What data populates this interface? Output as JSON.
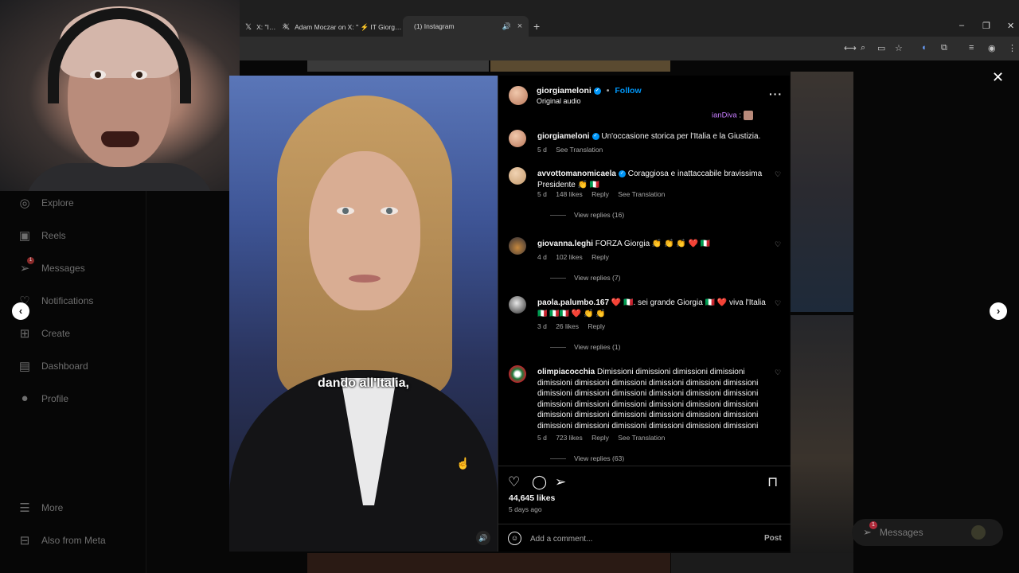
{
  "browser": {
    "tabs": [
      {
        "label": "X: \"I…",
        "active": false
      },
      {
        "label": "Adam Moczar on X: \" ⚡ IT Giorg…",
        "active": false
      },
      {
        "label": "(1) Instagram",
        "active": true
      }
    ],
    "new_tab": "+",
    "window_controls": {
      "minimize": "–",
      "restore": "❐",
      "close": "✕"
    }
  },
  "sidebar": {
    "items": [
      {
        "label": "Explore",
        "icon": "compass-icon"
      },
      {
        "label": "Reels",
        "icon": "reels-icon"
      },
      {
        "label": "Messages",
        "icon": "messenger-icon",
        "badge": "1"
      },
      {
        "label": "Notifications",
        "icon": "heart-icon"
      },
      {
        "label": "Create",
        "icon": "plus-square-icon"
      },
      {
        "label": "Dashboard",
        "icon": "chart-icon"
      },
      {
        "label": "Profile",
        "icon": "avatar-icon"
      }
    ],
    "more": "More",
    "also_from_meta": "Also from Meta"
  },
  "post": {
    "username": "giorgiameloni",
    "follow": "Follow",
    "audio": "Original audio",
    "subtitle": "dando all'Italia,",
    "pinned_user": "ianDiva",
    "caption_user": "giorgiameloni",
    "caption_text": "Un'occasione storica per l'Italia e la Giustizia.",
    "caption_age": "5 d",
    "caption_translation": "See Translation",
    "likes": "44,645 likes",
    "posted": "5 days ago",
    "comment_placeholder": "Add a comment...",
    "post_button": "Post"
  },
  "comments": [
    {
      "user": "avvottomanomicaela",
      "verified": true,
      "text": "Coraggiosa e inattaccabile bravissima Presidente 👏 🇮🇹",
      "age": "5 d",
      "likes": "148 likes",
      "reply": "Reply",
      "translate": "See Translation",
      "replies": "View replies (16)"
    },
    {
      "user": "giovanna.leghi",
      "verified": false,
      "text": "FORZA Giorgia 👏 👏 👏 ❤️ 🇮🇹",
      "age": "4 d",
      "likes": "102 likes",
      "reply": "Reply",
      "translate": "",
      "replies": "View replies (7)"
    },
    {
      "user": "paola.palumbo.167",
      "verified": false,
      "text": "❤️ 🇮🇹. sei grande Giorgia 🇮🇹 ❤️ viva l'Italia 🇮🇹 🇮🇹🇮🇹 ❤️ 👏 👏",
      "age": "3 d",
      "likes": "26 likes",
      "reply": "Reply",
      "translate": "",
      "replies": "View replies (1)"
    },
    {
      "user": "olimpiacocchia",
      "verified": false,
      "text": "Dimissioni dimissioni dimissioni dimissioni dimissioni dimissioni dimissioni dimissioni dimissioni dimissioni dimissioni dimissioni dimissioni dimissioni dimissioni dimissioni dimissioni dimissioni dimissioni dimissioni dimissioni dimissioni dimissioni dimissioni dimissioni dimissioni dimissioni dimissioni dimissioni dimissioni dimissioni dimissioni dimissioni dimissioni",
      "age": "5 d",
      "likes": "723 likes",
      "reply": "Reply",
      "translate": "See Translation",
      "replies": "View replies (63)"
    }
  ],
  "floating": {
    "messages": "Messages",
    "messages_badge": "1"
  },
  "colors": {
    "accent": "#0095f6",
    "pinned": "#c77dff",
    "muted": "#a8a8a8"
  }
}
